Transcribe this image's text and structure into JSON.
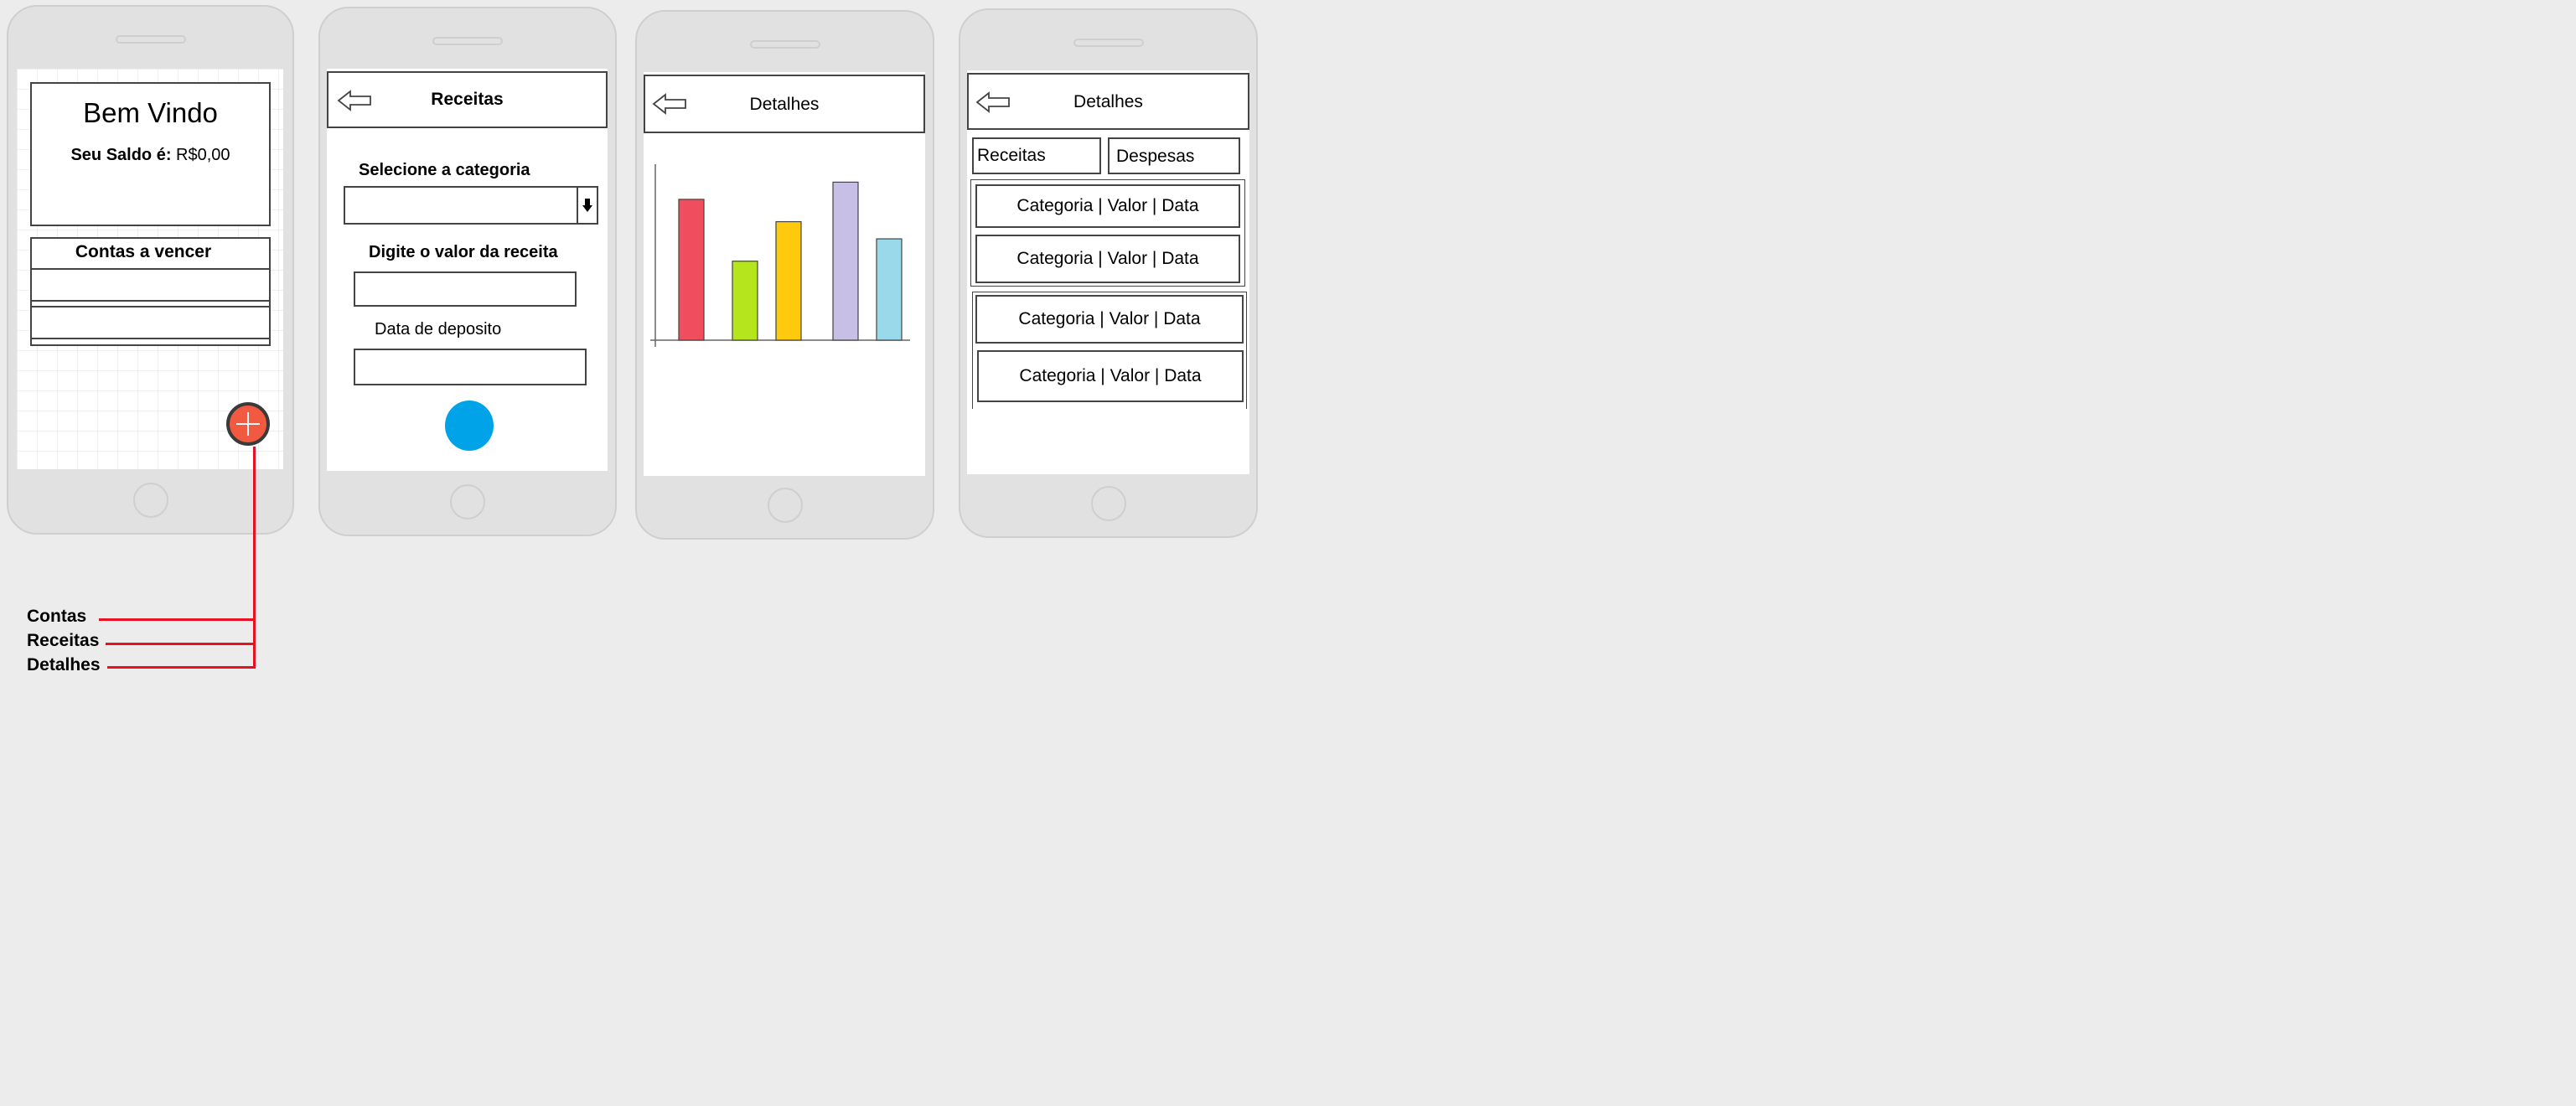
{
  "screen1": {
    "welcome": "Bem Vindo",
    "balance_label": "Seu Saldo é:",
    "balance_value": "R$0,00",
    "bills_title": "Contas a vencer"
  },
  "screen2": {
    "title": "Receitas",
    "category_label": "Selecione  a categoria",
    "value_label": "Digite o valor da receita",
    "date_label": "Data de deposito"
  },
  "screen3": {
    "title": "Detalhes"
  },
  "screen4": {
    "title": "Detalhes",
    "tab_income": "Receitas",
    "tab_expense": "Despesas",
    "rows": [
      "Categoria | Valor | Data",
      "Categoria | Valor | Data",
      "Categoria | Valor | Data",
      "Categoria | Valor | Data"
    ]
  },
  "fab_menu": {
    "items": [
      "Contas",
      "Receitas",
      "Detalhes"
    ]
  },
  "colors": {
    "fab": "#f15a40",
    "submit": "#00a2e8",
    "annotation": "#e81123"
  },
  "chart_data": {
    "type": "bar",
    "title": "",
    "xlabel": "",
    "ylabel": "",
    "ylim": [
      0,
      100
    ],
    "grid": false,
    "legend": "none",
    "categories": [
      "",
      "",
      "",
      "",
      ""
    ],
    "values": [
      82,
      46,
      69,
      92,
      59
    ],
    "colors": [
      "#f04e5e",
      "#b5e61d",
      "#ffc90e",
      "#c8bfe7",
      "#99d9ea"
    ],
    "gap_after_first": true
  }
}
